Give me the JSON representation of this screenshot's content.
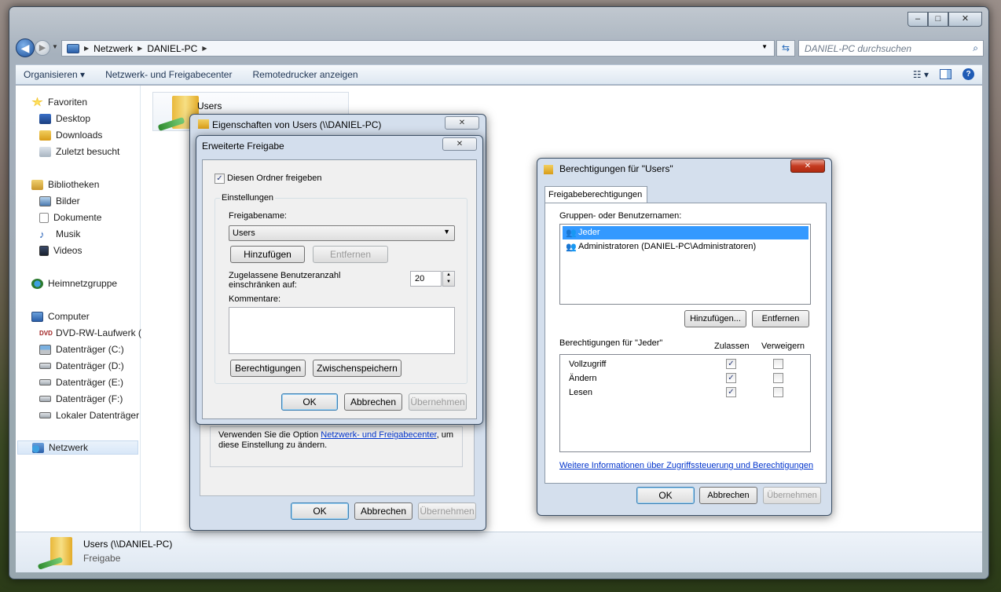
{
  "window": {
    "minimize": "–",
    "maximize": "□",
    "close": "✕"
  },
  "nav": {
    "breadcrumb": [
      "Netzwerk",
      "DANIEL-PC"
    ],
    "search_placeholder": "DANIEL-PC durchsuchen"
  },
  "toolbar": {
    "organize": "Organisieren ▾",
    "network_center": "Netzwerk- und Freigabecenter",
    "remote_printers": "Remotedrucker anzeigen"
  },
  "sidebar": {
    "favorites": "Favoriten",
    "desktop": "Desktop",
    "downloads": "Downloads",
    "recent": "Zuletzt besucht",
    "libraries": "Bibliotheken",
    "pictures": "Bilder",
    "documents": "Dokumente",
    "music": "Musik",
    "videos": "Videos",
    "homegroup": "Heimnetzgruppe",
    "computer": "Computer",
    "dvd": "DVD-RW-Laufwerk (",
    "drive_c": "Datenträger (C:)",
    "drive_d": "Datenträger (D:)",
    "drive_e": "Datenträger (E:)",
    "drive_f": "Datenträger (F:)",
    "local": "Lokaler Datenträger",
    "network": "Netzwerk"
  },
  "content": {
    "tile_label": "Users"
  },
  "details": {
    "name": "Users (\\\\DANIEL-PC)",
    "type": "Freigabe"
  },
  "props_dialog": {
    "title": "Eigenschaften von Users (\\\\DANIEL-PC)",
    "info_text_1": "Verwenden Sie die Option ",
    "info_link": "Netzwerk- und Freigabecenter",
    "info_text_2": ", um diese Einstellung zu ändern.",
    "ok": "OK",
    "cancel": "Abbrechen",
    "apply": "Übernehmen"
  },
  "adv_dialog": {
    "title": "Erweiterte Freigabe",
    "share_checkbox": "Diesen Ordner freigeben",
    "settings_group": "Einstellungen",
    "share_name_label": "Freigabename:",
    "share_name_value": "Users",
    "add": "Hinzufügen",
    "remove": "Entfernen",
    "limit_label": "Zugelassene Benutzeranzahl einschränken auf:",
    "limit_value": "20",
    "comments_label": "Kommentare:",
    "permissions": "Berechtigungen",
    "caching": "Zwischenspeichern",
    "ok": "OK",
    "cancel": "Abbrechen",
    "apply": "Übernehmen"
  },
  "perm_dialog": {
    "title": "Berechtigungen für \"Users\"",
    "tab": "Freigabeberechtigungen",
    "groups_label": "Gruppen- oder Benutzernamen:",
    "users": [
      "Jeder",
      "Administratoren (DANIEL-PC\\Administratoren)"
    ],
    "add": "Hinzufügen...",
    "remove": "Entfernen",
    "perms_for": "Berechtigungen für \"Jeder\"",
    "allow": "Zulassen",
    "deny": "Verweigern",
    "rows": [
      {
        "name": "Vollzugriff",
        "allow": true,
        "deny": false
      },
      {
        "name": "Ändern",
        "allow": true,
        "deny": false
      },
      {
        "name": "Lesen",
        "allow": true,
        "deny": false
      }
    ],
    "info_link": "Weitere Informationen über Zugriffssteuerung und Berechtigungen",
    "ok": "OK",
    "cancel": "Abbrechen",
    "apply": "Übernehmen"
  },
  "colors": {
    "selection": "#3399ff",
    "link": "#0033cc"
  }
}
